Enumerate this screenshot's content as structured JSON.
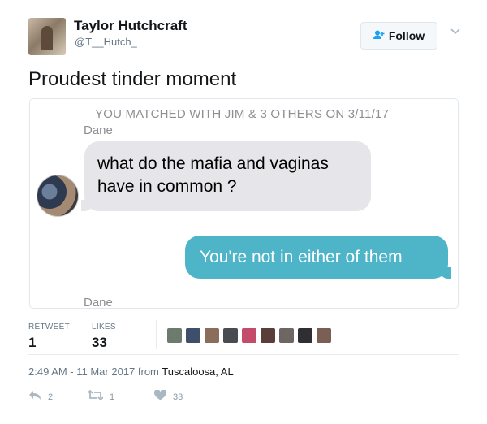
{
  "header": {
    "display_name": "Taylor Hutchcraft",
    "handle": "@T__Hutch_",
    "follow_label": "Follow",
    "follow_icon": "add-user-icon",
    "menu_icon": "chevron-down-icon"
  },
  "tweet": {
    "text": "Proudest tinder moment",
    "timestamp": "2:49 AM - 11 Mar 2017 from",
    "location": "Tuscaloosa, AL"
  },
  "screenshot": {
    "match_header": "YOU MATCHED WITH JIM & 3 OTHERS ON 3/11/17",
    "sender_top": "Dane",
    "incoming_message": "what do the mafia and vaginas have in common ?",
    "outgoing_message": "You're not in either of them",
    "sender_bottom": "Dane"
  },
  "stats": {
    "retweet_label": "RETWEET",
    "retweet_count": "1",
    "likes_label": "LIKES",
    "likes_count": "33"
  },
  "likers": [
    "#6d7a6e",
    "#3d4f6b",
    "#8a6d5a",
    "#4a4a52",
    "#c44b6a",
    "#5a3e3a",
    "#6e6662",
    "#2e2e33",
    "#7b5f55"
  ],
  "actions": {
    "reply_count": "2",
    "retweet_count": "1",
    "like_count": "33"
  },
  "colors": {
    "accent": "#1da1f2",
    "incoming_bubble": "#e5e5ea",
    "outgoing_bubble": "#4eb4c8"
  }
}
